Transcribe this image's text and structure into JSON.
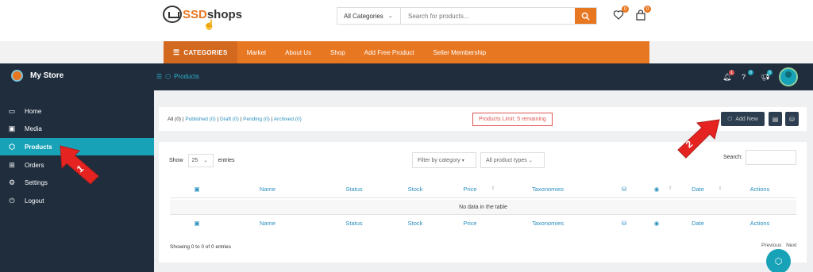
{
  "store_header": {
    "logo_ssd": "SSD",
    "logo_shops": "shops",
    "search_category": "All Categories",
    "search_placeholder": "Search for products...",
    "wishlist_count": "0",
    "cart_count": "0"
  },
  "store_nav": {
    "categories_label": "CATEGORIES",
    "items": [
      "Market",
      "About Us",
      "Shop",
      "Add Free Product",
      "Seller Membership"
    ]
  },
  "dashboard": {
    "store_name": "My Store",
    "breadcrumb": "Products",
    "notif_count": "1",
    "help_count": "0",
    "announce_count": "0"
  },
  "sidebar": {
    "items": [
      {
        "label": "Home",
        "icon": "monitor-icon"
      },
      {
        "label": "Media",
        "icon": "image-icon"
      },
      {
        "label": "Products",
        "icon": "box-icon"
      },
      {
        "label": "Orders",
        "icon": "cart-icon"
      },
      {
        "label": "Settings",
        "icon": "gears-icon"
      },
      {
        "label": "Logout",
        "icon": "power-icon"
      }
    ]
  },
  "filters": {
    "all": "All (0)",
    "published": "Published (0)",
    "draft": "Draft (0)",
    "pending": "Pending (0)",
    "archived": "Archived (0)",
    "sep": "|"
  },
  "limit_text": "Products Limit: 5 remaining",
  "add_new_label": "Add New",
  "table": {
    "show_label": "Show",
    "entries_label": "entries",
    "page_length": "25",
    "category_filter": "Filter by category",
    "type_filter": "All product types",
    "search_label": "Search:",
    "columns": [
      "Name",
      "Status",
      "Stock",
      "Price",
      "Taxonomies",
      "Date",
      "Actions"
    ],
    "empty_text": "No data in the table",
    "info": "Showing 0 to 0 of 0 entries",
    "previous": "Previous",
    "next": "Next"
  },
  "annotations": {
    "marker_1": "1",
    "marker_2": "2"
  }
}
